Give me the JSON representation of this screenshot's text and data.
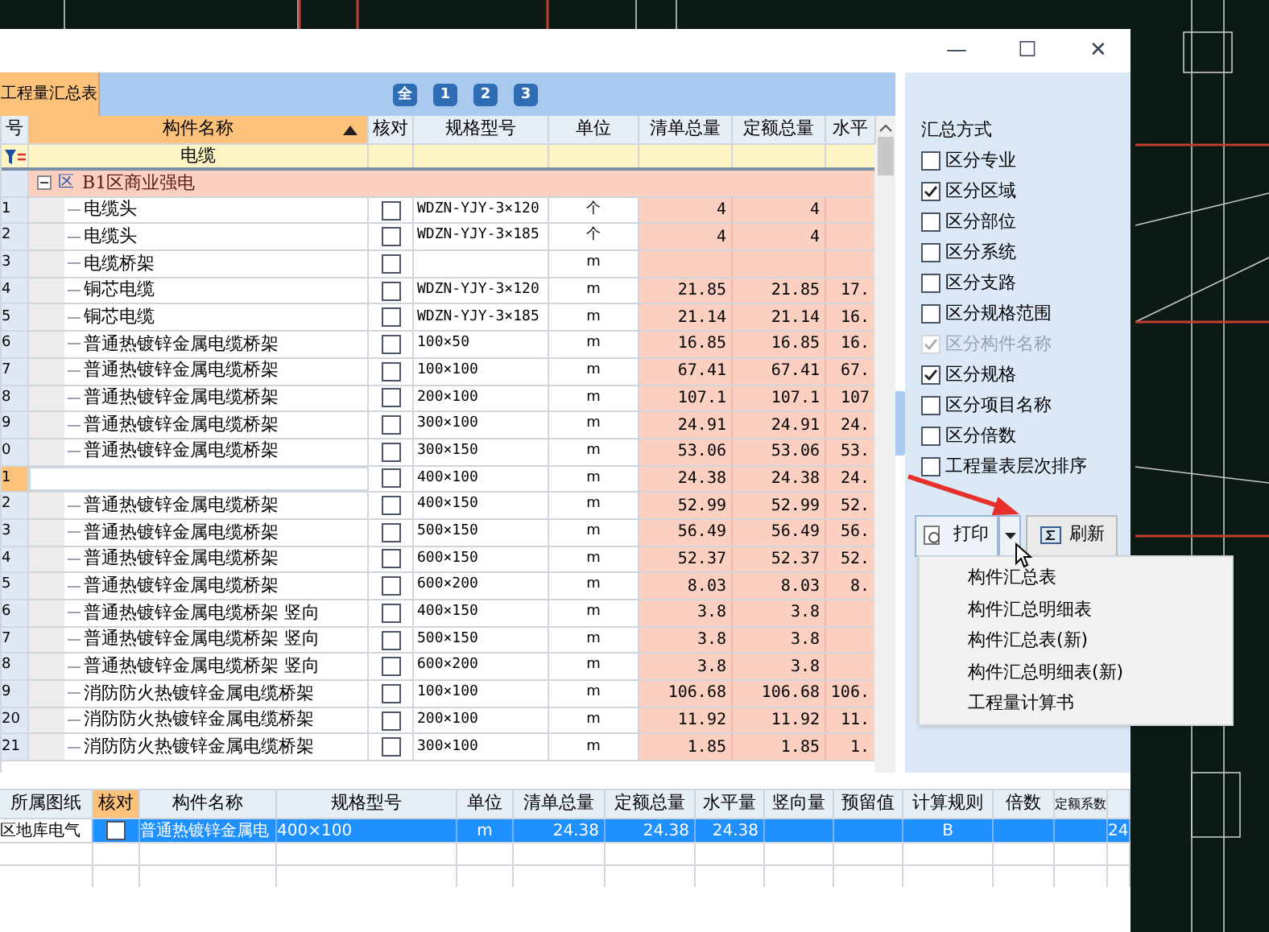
{
  "window": {
    "controls": [
      "—",
      "☐",
      "✕"
    ]
  },
  "tab": {
    "label": "工程量汇总表",
    "selected": true
  },
  "levels": [
    "全",
    "1",
    "2",
    "3"
  ],
  "table": {
    "columns": [
      "号",
      "构件名称",
      "核对",
      "规格型号",
      "单位",
      "清单总量",
      "定额总量",
      "水平"
    ],
    "filter": {
      "name": "电缆"
    },
    "group": {
      "expanded": true,
      "badge": "区",
      "label": "B1区商业强电"
    },
    "rows": [
      {
        "no": "1",
        "name": "电缆头",
        "checked": false,
        "spec": "WDZN-YJY-3×120",
        "unit": "个",
        "q1": "4",
        "q2": "4",
        "h": "",
        "selected": false
      },
      {
        "no": "2",
        "name": "电缆头",
        "checked": false,
        "spec": "WDZN-YJY-3×185",
        "unit": "个",
        "q1": "4",
        "q2": "4",
        "h": "",
        "selected": false
      },
      {
        "no": "3",
        "name": "电缆桥架",
        "checked": false,
        "spec": "",
        "unit": "m",
        "q1": "",
        "q2": "",
        "h": "",
        "selected": false
      },
      {
        "no": "4",
        "name": "铜芯电缆",
        "checked": false,
        "spec": "WDZN-YJY-3×120",
        "unit": "m",
        "q1": "21.85",
        "q2": "21.85",
        "h": "17.",
        "selected": false
      },
      {
        "no": "5",
        "name": "铜芯电缆",
        "checked": false,
        "spec": "WDZN-YJY-3×185",
        "unit": "m",
        "q1": "21.14",
        "q2": "21.14",
        "h": "16.",
        "selected": false
      },
      {
        "no": "6",
        "name": "普通热镀锌金属电缆桥架",
        "checked": false,
        "spec": "100×50",
        "unit": "m",
        "q1": "16.85",
        "q2": "16.85",
        "h": "16.",
        "selected": false
      },
      {
        "no": "7",
        "name": "普通热镀锌金属电缆桥架",
        "checked": false,
        "spec": "100×100",
        "unit": "m",
        "q1": "67.41",
        "q2": "67.41",
        "h": "67.",
        "selected": false
      },
      {
        "no": "8",
        "name": "普通热镀锌金属电缆桥架",
        "checked": false,
        "spec": "200×100",
        "unit": "m",
        "q1": "107.1",
        "q2": "107.1",
        "h": "107",
        "selected": false
      },
      {
        "no": "9",
        "name": "普通热镀锌金属电缆桥架",
        "checked": false,
        "spec": "300×100",
        "unit": "m",
        "q1": "24.91",
        "q2": "24.91",
        "h": "24.",
        "selected": false
      },
      {
        "no": "0",
        "name": "普通热镀锌金属电缆桥架",
        "checked": false,
        "spec": "300×150",
        "unit": "m",
        "q1": "53.06",
        "q2": "53.06",
        "h": "53.",
        "selected": false
      },
      {
        "no": "1",
        "name": "",
        "checked": false,
        "spec": "400×100",
        "unit": "m",
        "q1": "24.38",
        "q2": "24.38",
        "h": "24.",
        "selected": true
      },
      {
        "no": "2",
        "name": "普通热镀锌金属电缆桥架",
        "checked": false,
        "spec": "400×150",
        "unit": "m",
        "q1": "52.99",
        "q2": "52.99",
        "h": "52.",
        "selected": false
      },
      {
        "no": "3",
        "name": "普通热镀锌金属电缆桥架",
        "checked": false,
        "spec": "500×150",
        "unit": "m",
        "q1": "56.49",
        "q2": "56.49",
        "h": "56.",
        "selected": false
      },
      {
        "no": "4",
        "name": "普通热镀锌金属电缆桥架",
        "checked": false,
        "spec": "600×150",
        "unit": "m",
        "q1": "52.37",
        "q2": "52.37",
        "h": "52.",
        "selected": false
      },
      {
        "no": "5",
        "name": "普通热镀锌金属电缆桥架",
        "checked": false,
        "spec": "600×200",
        "unit": "m",
        "q1": "8.03",
        "q2": "8.03",
        "h": "8.",
        "selected": false
      },
      {
        "no": "6",
        "name": "普通热镀锌金属电缆桥架 竖向",
        "checked": false,
        "spec": "400×150",
        "unit": "m",
        "q1": "3.8",
        "q2": "3.8",
        "h": "",
        "selected": false
      },
      {
        "no": "7",
        "name": "普通热镀锌金属电缆桥架 竖向",
        "checked": false,
        "spec": "500×150",
        "unit": "m",
        "q1": "3.8",
        "q2": "3.8",
        "h": "",
        "selected": false
      },
      {
        "no": "8",
        "name": "普通热镀锌金属电缆桥架 竖向",
        "checked": false,
        "spec": "600×200",
        "unit": "m",
        "q1": "3.8",
        "q2": "3.8",
        "h": "",
        "selected": false
      },
      {
        "no": "9",
        "name": "消防防火热镀锌金属电缆桥架",
        "checked": false,
        "spec": "100×100",
        "unit": "m",
        "q1": "106.68",
        "q2": "106.68",
        "h": "106.",
        "selected": false
      },
      {
        "no": "20",
        "name": "消防防火热镀锌金属电缆桥架",
        "checked": false,
        "spec": "200×100",
        "unit": "m",
        "q1": "11.92",
        "q2": "11.92",
        "h": "11.",
        "selected": false
      },
      {
        "no": "21",
        "name": "消防防火热镀锌金属电缆桥架",
        "checked": false,
        "spec": "300×100",
        "unit": "m",
        "q1": "1.85",
        "q2": "1.85",
        "h": "1.",
        "selected": false
      }
    ]
  },
  "summary": {
    "title": "汇总方式",
    "options": [
      {
        "label": "区分专业",
        "checked": false,
        "disabled": false
      },
      {
        "label": "区分区域",
        "checked": true,
        "disabled": false
      },
      {
        "label": "区分部位",
        "checked": false,
        "disabled": false
      },
      {
        "label": "区分系统",
        "checked": false,
        "disabled": false
      },
      {
        "label": "区分支路",
        "checked": false,
        "disabled": false
      },
      {
        "label": "区分规格范围",
        "checked": false,
        "disabled": false
      },
      {
        "label": "区分构件名称",
        "checked": true,
        "disabled": true
      },
      {
        "label": "区分规格",
        "checked": true,
        "disabled": false
      },
      {
        "label": "区分项目名称",
        "checked": false,
        "disabled": false
      },
      {
        "label": "区分倍数",
        "checked": false,
        "disabled": false
      },
      {
        "label": "工程量表层次排序",
        "checked": false,
        "disabled": false
      }
    ],
    "print_button": "打印",
    "refresh_button": "刷新",
    "menu": [
      "构件汇总表",
      "构件汇总明细表",
      "构件汇总表(新)",
      "构件汇总明细表(新)",
      "工程量计算书"
    ]
  },
  "detail": {
    "columns": [
      "所属图纸",
      "核对",
      "构件名称",
      "规格型号",
      "单位",
      "清单总量",
      "定额总量",
      "水平量",
      "竖向量",
      "预留值",
      "计算规则",
      "倍数",
      "定额系数",
      ""
    ],
    "rows": [
      {
        "selected": true,
        "checked": false,
        "cells": [
          "区地库电气",
          "",
          "普通热镀锌金属电",
          "400×100",
          "m",
          "24.38",
          "24.38",
          "24.38",
          "",
          "",
          "B",
          "",
          "",
          "24"
        ]
      }
    ]
  }
}
